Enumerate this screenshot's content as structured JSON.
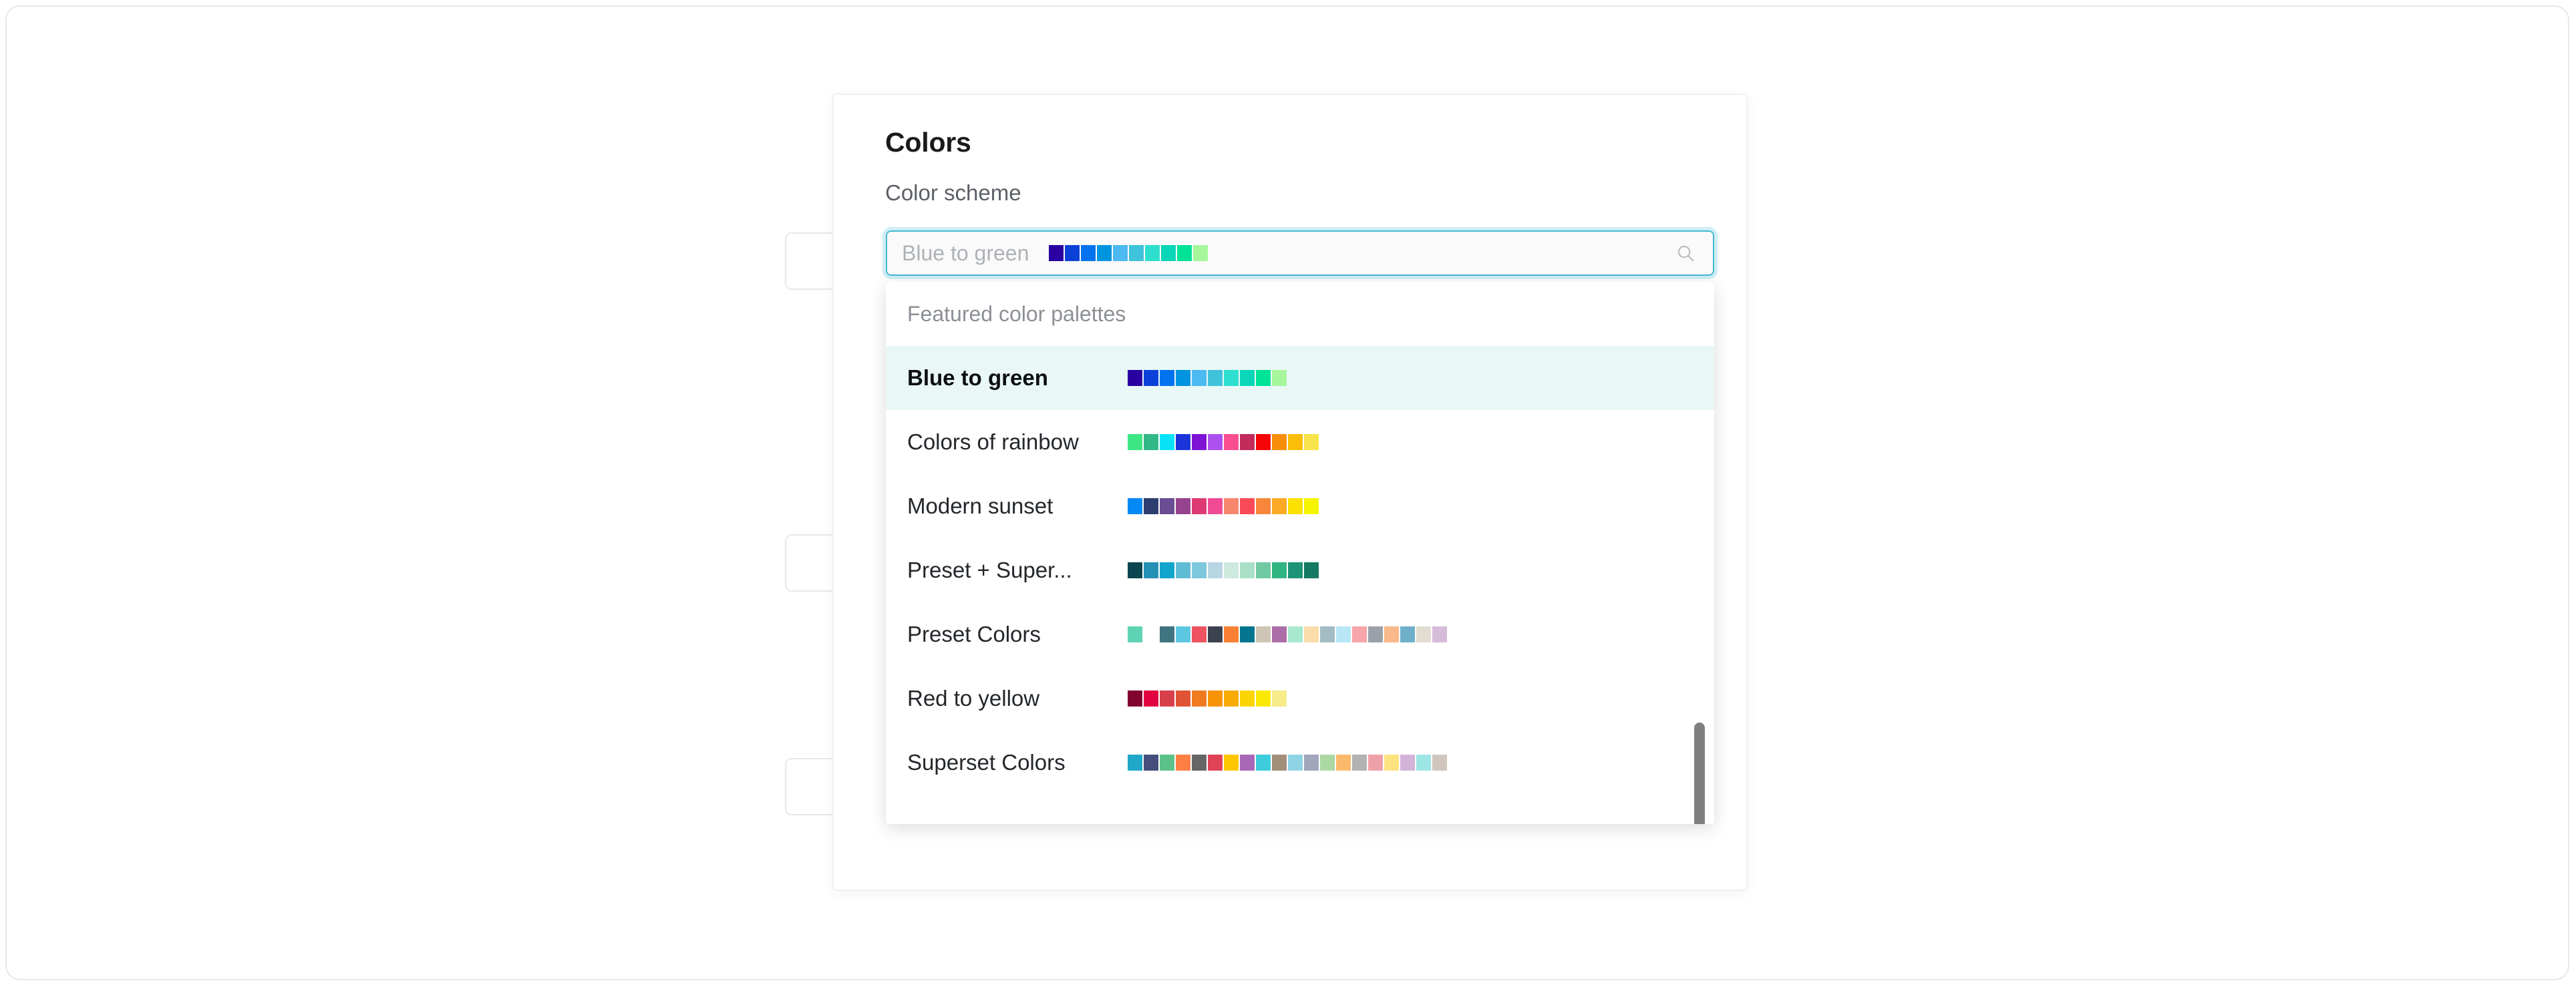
{
  "panel": {
    "title": "Colors",
    "field_label": "Color scheme"
  },
  "select": {
    "placeholder": "Blue to green",
    "value": "",
    "search_icon": "search-icon",
    "preview_palette": [
      "#2a00a2",
      "#0a41d8",
      "#0372ef",
      "#0094e0",
      "#4cb9f0",
      "#3fc3da",
      "#2edfcf",
      "#0ad6b8",
      "#00e396",
      "#a6f79c"
    ]
  },
  "dropdown": {
    "group_header": "Featured color palettes",
    "selected_index": 0,
    "options": [
      {
        "label": "Blue to green",
        "selected": true,
        "colors": [
          "#2a00a2",
          "#0a41d8",
          "#0372ef",
          "#0094e0",
          "#4cb9f0",
          "#3fc3da",
          "#2edfcf",
          "#0ad6b8",
          "#00e396",
          "#a6f79c"
        ]
      },
      {
        "label": "Colors of rainbow",
        "selected": false,
        "colors": [
          "#3ee683",
          "#32b887",
          "#0ae3f7",
          "#1c35db",
          "#7e13d4",
          "#ac51f0",
          "#f94f91",
          "#c32b5c",
          "#f50505",
          "#f78e08",
          "#fcbd09",
          "#f7e44a"
        ]
      },
      {
        "label": "Modern sunset",
        "selected": false,
        "colors": [
          "#058af5",
          "#2c3d6e",
          "#6a4d92",
          "#96438f",
          "#dd3a74",
          "#f04b95",
          "#f7866f",
          "#fb4a57",
          "#f7863b",
          "#fbaa26",
          "#fbe000",
          "#f5f500"
        ]
      },
      {
        "label": "Preset + Super...",
        "full_label": "Preset + Superset",
        "selected": false,
        "colors": [
          "#0b4551",
          "#2590b5",
          "#12a5cc",
          "#5fbcd4",
          "#7ec8dd",
          "#b7d6e3",
          "#cdeade",
          "#a9e0c7",
          "#6fc9a2",
          "#2fb582",
          "#1d9476",
          "#157a63"
        ]
      },
      {
        "label": "Preset Colors",
        "selected": false,
        "colors": [
          "#5ed3b3",
          "#fbc game",
          "#3f7480",
          "#5cc7e0",
          "#ef5361",
          "#3c4250",
          "#fa8034",
          "#03758f",
          "#cfc5b4",
          "#ab6ea8",
          "#a7e8cf",
          "#fbddab",
          "#a1bcc2",
          "#b7e7f7",
          "#f7a5ab",
          "#9ba1a8",
          "#f9b98a",
          "#6fb0c9",
          "#e3ddd1",
          "#d5bcd9"
        ]
      },
      {
        "label": "Red to yellow",
        "selected": false,
        "colors": [
          "#80042e",
          "#e00340",
          "#d6404a",
          "#e05433",
          "#ef7a20",
          "#f79305",
          "#f7ab03",
          "#fbd403",
          "#fbe803",
          "#f7eb8a"
        ]
      },
      {
        "label": "Superset Colors",
        "selected": false,
        "colors": [
          "#1fa8c9",
          "#454e7c",
          "#5ac189",
          "#ff7f44",
          "#666666",
          "#e04355",
          "#fcc700",
          "#a868b7",
          "#3cccdb",
          "#a38f79",
          "#8fd3e4",
          "#a1a6bd",
          "#acd8a4",
          "#fdb96b",
          "#b2b2b2",
          "#efa1aa",
          "#fde380",
          "#d3b3da",
          "#9ee5e5",
          "#d1c6be"
        ]
      }
    ]
  },
  "scrollbar": {
    "thumb_color": "#7f7f7f"
  },
  "colors": {
    "accent": "#49b8d6",
    "selected_row_bg": "#e9f8f7",
    "placeholder_text": "#aeb2b7"
  }
}
